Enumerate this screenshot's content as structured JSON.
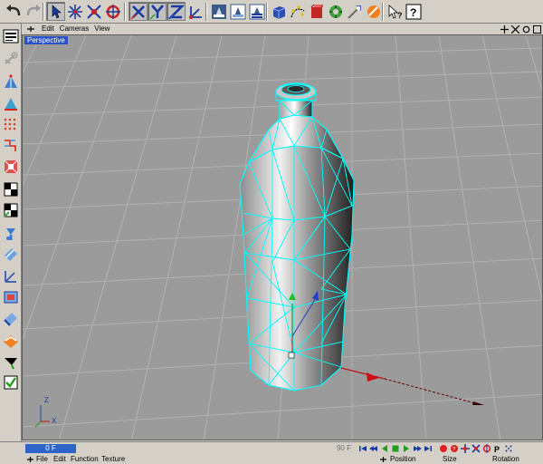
{
  "viewport": {
    "menu": [
      "Edit",
      "Cameras",
      "View"
    ],
    "label": "Perspective",
    "axis_labels": [
      "Z",
      "X"
    ]
  },
  "toolbar": {
    "icons": [
      "undo-icon",
      "redo-icon",
      "select-arrow-icon",
      "move-icon",
      "scale-icon",
      "rotate-icon",
      "x-axis-lock-icon",
      "y-axis-lock-icon",
      "z-axis-lock-icon",
      "coordinate-system-icon",
      "render-active-view-icon",
      "render-to-picture-viewer-icon",
      "render-settings-icon",
      "cube-primitive-icon",
      "spline-pen-icon",
      "nurbs-icon",
      "array-icon",
      "deformer-icon",
      "light-icon",
      "material-icon",
      "help-icon",
      "help-context-icon"
    ]
  },
  "left_toolbar": {
    "icons": [
      "use-model-icon",
      "use-object-axis-icon",
      "use-points-icon",
      "use-edges-icon",
      "use-polygons-icon",
      "use-animation-icon",
      "use-texture-icon",
      "texture-axis-icon",
      "use-object-icon",
      "bone-icon",
      "soft-selection-icon",
      "tweak-icon",
      "magnet-icon",
      "brush-icon",
      "layer-icon",
      "snap-icon",
      "workplane-icon"
    ]
  },
  "timeline": {
    "current_frame": "0 F",
    "end_frame": "90 F"
  },
  "bottom_menu": {
    "items": [
      "File",
      "Edit",
      "Function",
      "Texture"
    ],
    "coord_headers": [
      "Position",
      "Size",
      "Rotation"
    ]
  },
  "colors": {
    "viewport_bg": "#9b9b9b",
    "grid": "#b0b0b0",
    "wireframe": "#00ffff",
    "ui_bg": "#d4d0c8",
    "accent_blue": "#2e64c8"
  }
}
